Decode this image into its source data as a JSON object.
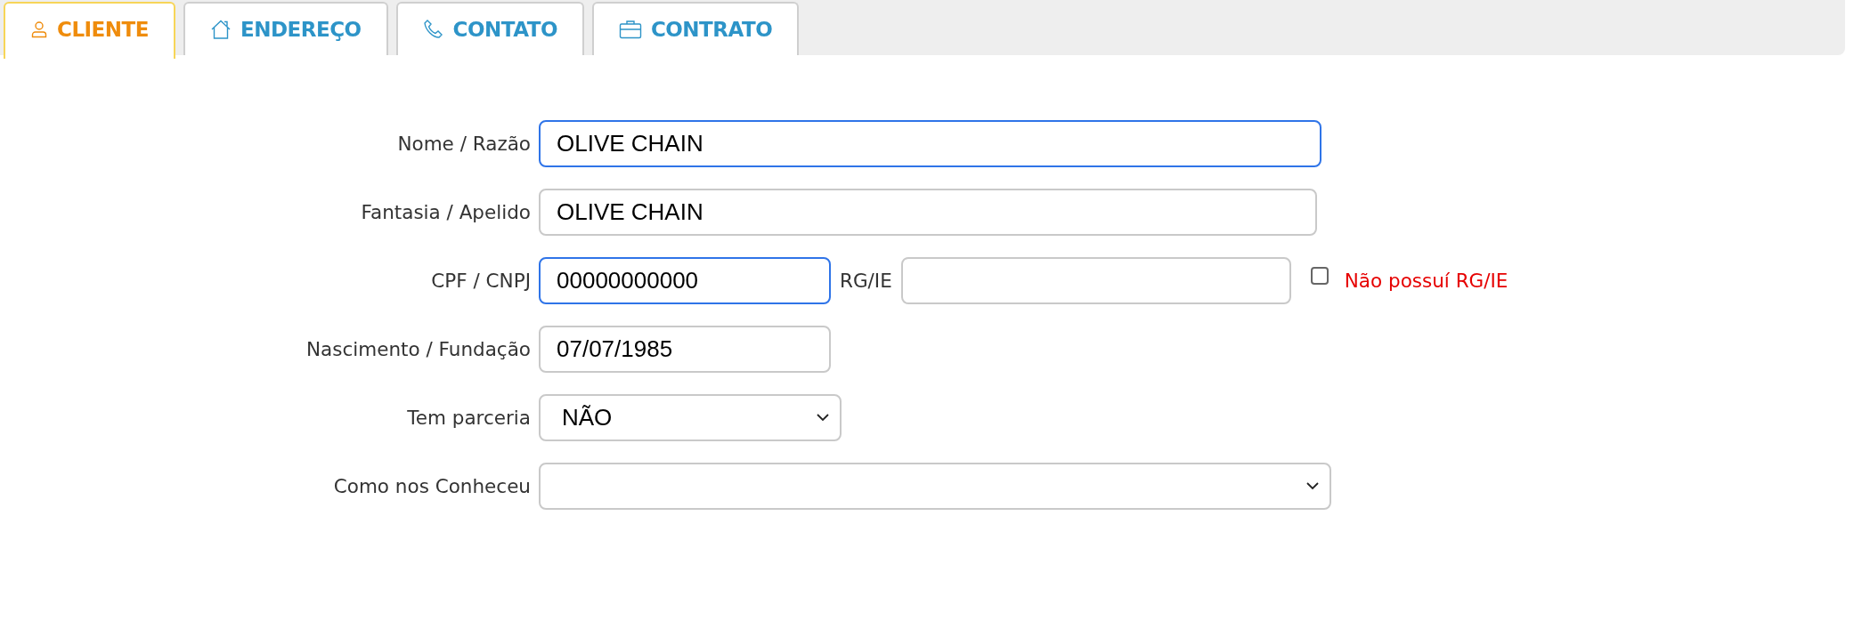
{
  "tabs": [
    {
      "label": "CLIENTE",
      "selected": true
    },
    {
      "label": "ENDEREÇO",
      "selected": false
    },
    {
      "label": "CONTATO",
      "selected": false
    },
    {
      "label": "CONTRATO",
      "selected": false
    }
  ],
  "form": [
    {
      "label": "Nome / Razão",
      "controls": [
        {
          "kind": "input",
          "value": "OLIVE CHAIN",
          "highlighted": true
        }
      ]
    },
    {
      "label": "Fantasia / Apelido",
      "controls": [
        {
          "kind": "input",
          "value": "OLIVE CHAIN",
          "highlighted": false
        }
      ]
    },
    {
      "label": "CPF / CNPJ",
      "controls": [
        {
          "kind": "input",
          "value": "00000000000",
          "highlighted": true
        },
        {
          "kind": "label",
          "text": "RG/IE"
        },
        {
          "kind": "input",
          "highlighted": false
        },
        {
          "kind": "checkbox",
          "text": "Não possuí RG/IE",
          "checked": false
        }
      ]
    },
    {
      "label": "Nascimento / Fundação",
      "controls": [
        {
          "kind": "input",
          "value": "07/07/1985",
          "highlighted": false
        }
      ]
    },
    {
      "label": "Tem parceria",
      "controls": [
        {
          "kind": "select",
          "value": "NÃO"
        }
      ]
    },
    {
      "label": "Como nos Conheceu",
      "controls": [
        {
          "kind": "select"
        }
      ]
    }
  ]
}
